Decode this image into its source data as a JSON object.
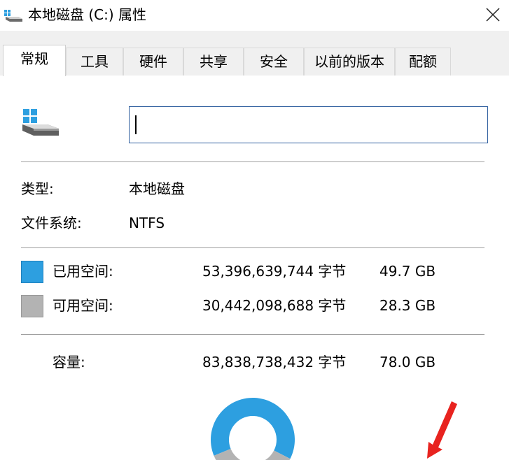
{
  "window": {
    "title": "本地磁盘 (C:) 属性",
    "close_icon": "close-icon",
    "drive_icon": "drive-icon"
  },
  "tabs": [
    {
      "label": "常规",
      "active": true
    },
    {
      "label": "工具",
      "active": false
    },
    {
      "label": "硬件",
      "active": false
    },
    {
      "label": "共享",
      "active": false
    },
    {
      "label": "安全",
      "active": false
    },
    {
      "label": "以前的版本",
      "active": false
    },
    {
      "label": "配额",
      "active": false
    }
  ],
  "general": {
    "name_value": "",
    "type_label": "类型:",
    "type_value": "本地磁盘",
    "fs_label": "文件系统:",
    "fs_value": "NTFS",
    "used_label": "已用空间:",
    "used_bytes": "53,396,639,744 字节",
    "used_size": "49.7 GB",
    "free_label": "可用空间:",
    "free_bytes": "30,442,098,688 字节",
    "free_size": "28.3 GB",
    "capacity_label": "容量:",
    "capacity_bytes": "83,838,738,432 字节",
    "capacity_size": "78.0 GB"
  },
  "chart_data": {
    "type": "pie",
    "categories": [
      "已用空间",
      "可用空间"
    ],
    "values": [
      49.7,
      28.3
    ],
    "colors": [
      "#2d9fe0",
      "#b3b3b3"
    ]
  },
  "colors": {
    "used": "#2d9fe0",
    "free": "#b3b3b3",
    "annotation_arrow": "#e8231f"
  }
}
